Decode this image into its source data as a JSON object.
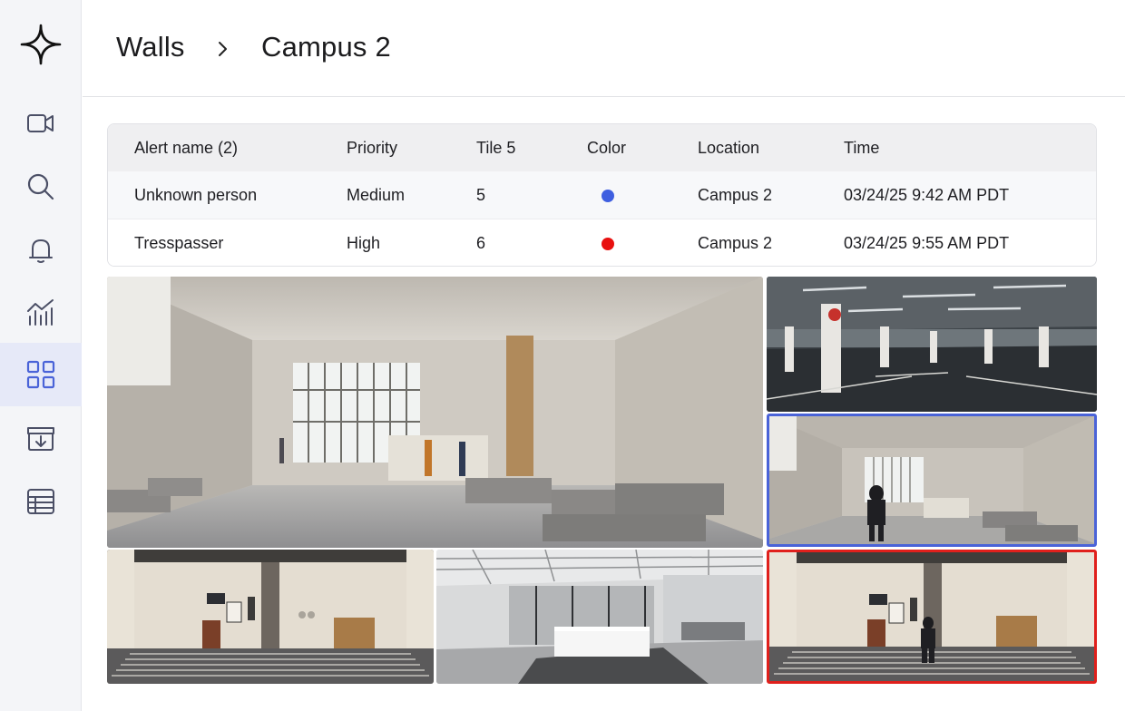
{
  "breadcrumb": {
    "parent": "Walls",
    "current": "Campus 2"
  },
  "sidebar": {
    "items": [
      {
        "icon": "video-camera-icon",
        "active": false
      },
      {
        "icon": "search-icon",
        "active": false
      },
      {
        "icon": "bell-icon",
        "active": false
      },
      {
        "icon": "analytics-chart-icon",
        "active": false
      },
      {
        "icon": "grid-icon",
        "active": true
      },
      {
        "icon": "archive-download-icon",
        "active": false
      },
      {
        "icon": "table-icon",
        "active": false
      }
    ]
  },
  "alerts_table": {
    "headers": {
      "name": "Alert name (2)",
      "priority": "Priority",
      "tile": "Tile 5",
      "color": "Color",
      "location": "Location",
      "time": "Time"
    },
    "rows": [
      {
        "name": "Unknown person",
        "priority": "Medium",
        "tile": "5",
        "color": "#3f5fe0",
        "location": "Campus 2",
        "time": "03/24/25 9:42 AM PDT"
      },
      {
        "name": "Tresspasser",
        "priority": "High",
        "tile": "6",
        "color": "#e8100f",
        "location": "Campus 2",
        "time": "03/24/25 9:55 AM PDT"
      }
    ]
  },
  "colors": {
    "accent": "#4a63d8",
    "alert_high": "#e0201c",
    "active_nav_bg": "#e6e9f8"
  },
  "camera_tiles": [
    {
      "scene": "atrium-lobby",
      "highlight": "none"
    },
    {
      "scene": "parking-garage",
      "highlight": "none"
    },
    {
      "scene": "lobby-person",
      "highlight": "blue"
    },
    {
      "scene": "reception-wall",
      "highlight": "none"
    },
    {
      "scene": "open-office",
      "highlight": "none"
    },
    {
      "scene": "reception-wall-person",
      "highlight": "red"
    }
  ]
}
